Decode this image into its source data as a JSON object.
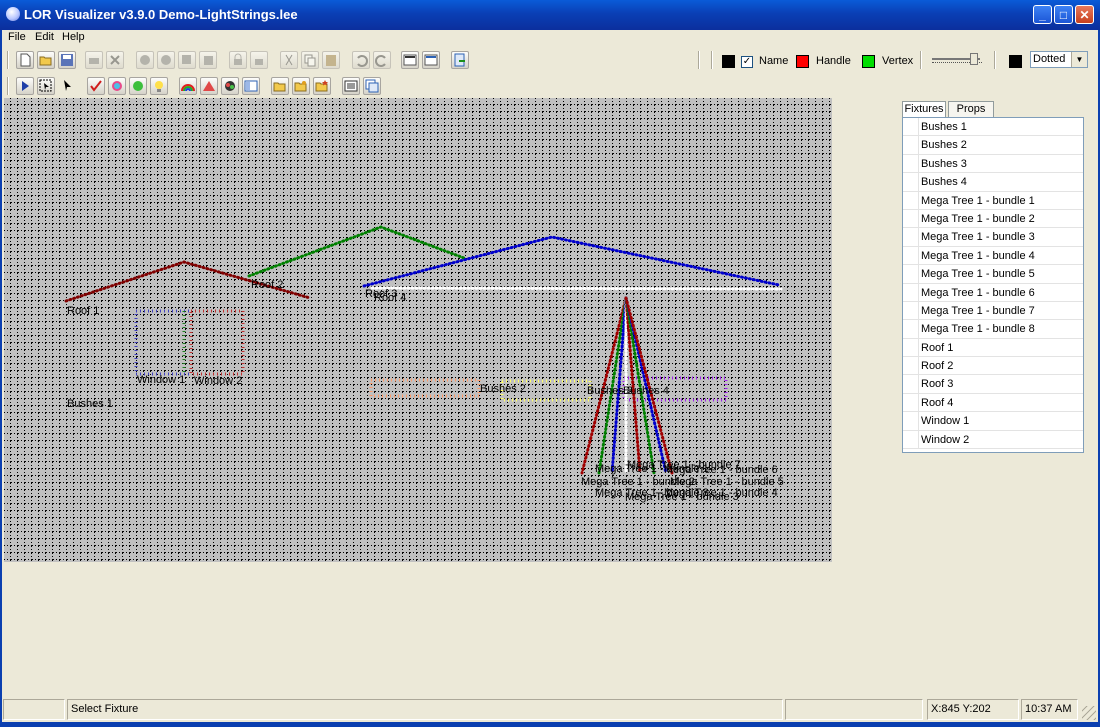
{
  "window": {
    "title": "LOR Visualizer v3.9.0 Demo-LightStrings.lee"
  },
  "menu": [
    {
      "label": "File"
    },
    {
      "label": "Edit"
    },
    {
      "label": "Help"
    }
  ],
  "colors": {
    "name_swatch": "#000000",
    "handle_swatch": "#ff0000",
    "vertex_swatch": "#00dd00",
    "grid_swatch": "#000000",
    "canvas_background": "#c0c0c0",
    "title_bar": "#0a3fb5"
  },
  "toolbar": {
    "name_label": "Name",
    "name_checked": true,
    "handle_label": "Handle",
    "vertex_label": "Vertex",
    "line_style_value": "Dotted"
  },
  "toolbar_icons": {
    "row1": [
      "new-file-icon",
      "open-folder-icon",
      "save-icon",
      "print-icon",
      "delete-icon",
      "group-icon",
      "ungroup-icon",
      "bring-front-icon",
      "send-back-icon",
      "lock-icon",
      "unlock-icon",
      "cut-icon",
      "copy-icon",
      "paste-icon",
      "undo-icon",
      "redo-icon",
      "properties-icon",
      "grid-icon",
      "export-icon"
    ],
    "row2": [
      "play-icon",
      "select-region-icon",
      "pointer-icon",
      "check-icon",
      "color-wheel-icon",
      "bulb-green-icon",
      "bulb-yellow-icon",
      "rainbow-icon",
      "triangle-icon",
      "palette-icon",
      "layout-icon",
      "open-file-icon",
      "folder-icon",
      "folder-star-icon",
      "list-icon",
      "copy-window-icon"
    ]
  },
  "panel": {
    "tabs": [
      {
        "label": "Fixtures"
      },
      {
        "label": "Props"
      }
    ],
    "items": [
      "Bushes 1",
      "Bushes 2",
      "Bushes 3",
      "Bushes 4",
      "Mega Tree 1 - bundle 1",
      "Mega Tree 1 - bundle 2",
      "Mega Tree 1 - bundle 3",
      "Mega Tree 1 - bundle 4",
      "Mega Tree 1 - bundle 5",
      "Mega Tree 1 - bundle 6",
      "Mega Tree 1 - bundle 7",
      "Mega Tree 1 - bundle 8",
      "Roof 1",
      "Roof 2",
      "Roof 3",
      "Roof 4",
      "Window 1",
      "Window 2"
    ]
  },
  "canvas_labels": {
    "roof1": "Roof 1",
    "roof2": "Roof 2",
    "roof3": "Roof 3",
    "roof4": "Roof 4",
    "window1": "Window 1",
    "window2": "Window 2",
    "bushes1": "Bushes 1",
    "bushes2": "Bushes 2",
    "bushes3": "Bushes 3",
    "bushes4": "Bushes 4",
    "mt1": "Mega Tree 1 - bundle 1",
    "mt2": "Mega Tree 1 - bundle 2",
    "mt3": "Mega Tree 1 - bundle 3",
    "mt4": "Mega Tree 1 - bundle 4",
    "mt5": "Mega Tree 1 - bundle 5",
    "mt6": "Mega Tree 1 - bundle 6",
    "mt7": "Mega Tree 1 - bundle 7",
    "mt8": "Mega Tree 1 - bundle 8"
  },
  "fixture_colors": {
    "roof1": "#800000",
    "roof2": "#008000",
    "roof3": "#0000cc",
    "roof4": "#ffffff",
    "bushes2": "#ff9966",
    "bushes3": "#ffff66",
    "bushes4": "#a020f0"
  },
  "status": {
    "message": "Select Fixture",
    "coords": "X:845 Y:202",
    "time": "10:37 AM"
  }
}
